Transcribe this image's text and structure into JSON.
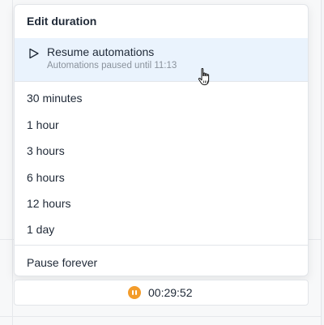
{
  "menu": {
    "title": "Edit duration",
    "resume": {
      "label": "Resume automations",
      "subtitle": "Automations paused until 11:13"
    },
    "options": [
      "30 minutes",
      "1 hour",
      "3 hours",
      "6 hours",
      "12 hours",
      "1 day"
    ],
    "pause_forever": "Pause forever"
  },
  "timer": {
    "value": "00:29:52",
    "icon": "pause-icon",
    "icon_color": "#f39c2b"
  },
  "colors": {
    "highlight": "#eaf3fd"
  }
}
